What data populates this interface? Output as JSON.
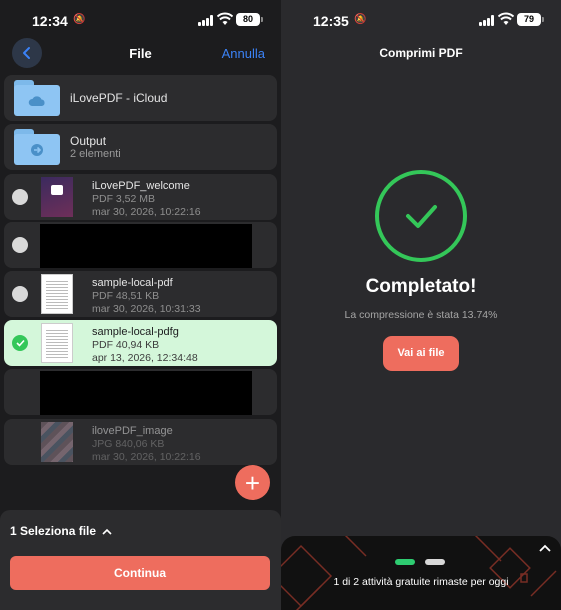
{
  "left_screen": {
    "status": {
      "time": "12:34",
      "battery": "80"
    },
    "nav": {
      "title": "File",
      "cancel_label": "Annulla"
    },
    "folders": [
      {
        "name": "iLovePDF - iCloud",
        "subtitle": ""
      },
      {
        "name": "Output",
        "subtitle": "2 elementi"
      }
    ],
    "files": [
      {
        "name": "iLovePDF_welcome",
        "meta1": "PDF 3,52 MB",
        "meta2": "mar 30, 2026, 10:22:16",
        "selected": false
      },
      {
        "name": "sample-local-pdf",
        "meta1": "PDF 48,51 KB",
        "meta2": "mar 30, 2026, 10:31:33",
        "selected": false
      },
      {
        "name": "sample-local-pdfg",
        "meta1": "PDF 40,94 KB",
        "meta2": "apr 13, 2026, 12:34:48",
        "selected": true
      },
      {
        "name": "ilovePDF_image",
        "meta1": "JPG 840,06 KB",
        "meta2": "mar 30, 2026, 10:22:16",
        "selected": false
      }
    ],
    "fab_label": "+",
    "bottom": {
      "selection_label": "1 Seleziona file",
      "continue_label": "Continua"
    }
  },
  "right_screen": {
    "status": {
      "time": "12:35",
      "battery": "79"
    },
    "title": "Comprimi PDF",
    "result_heading": "Completato!",
    "result_detail": "La compressione è stata 13.74%",
    "go_button_label": "Vai ai file",
    "promo_text": "1 di 2 attività gratuite rimaste per oggi"
  },
  "colors": {
    "accent": "#ee6d5e",
    "success": "#34c759",
    "link": "#3b82f6",
    "selected_row": "#d4f7da",
    "folder": "#8ec5f3"
  }
}
